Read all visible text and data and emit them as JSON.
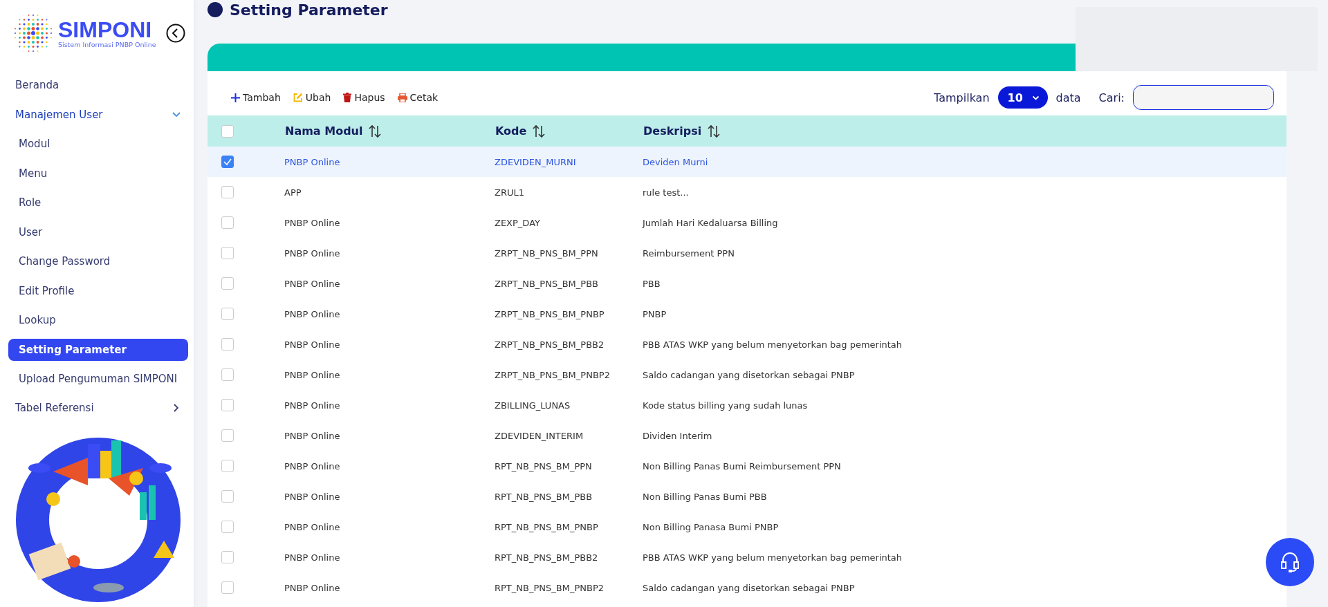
{
  "sidebar": {
    "logo": {
      "name": "SIMPONI",
      "tagline": "Sistem Informasi PNBP Online"
    },
    "items": [
      {
        "label": "Beranda",
        "selected": false
      },
      {
        "label": "Manajemen User",
        "selected": false,
        "expanded": true,
        "children": [
          {
            "label": "Modul",
            "selected": false
          },
          {
            "label": "Menu",
            "selected": false
          },
          {
            "label": "Role",
            "selected": false
          },
          {
            "label": "User",
            "selected": false
          },
          {
            "label": "Change Password",
            "selected": false
          },
          {
            "label": "Edit Profile",
            "selected": false
          },
          {
            "label": "Lookup",
            "selected": false
          },
          {
            "label": "Setting Parameter",
            "selected": true
          },
          {
            "label": "Upload Pengumuman SIMPONI",
            "selected": false
          }
        ]
      },
      {
        "label": "Tabel Referensi",
        "selected": false,
        "expanded": false
      }
    ]
  },
  "page_title": "Setting Parameter",
  "toolbar": {
    "actions": [
      {
        "kind": "add",
        "label": "Tambah"
      },
      {
        "kind": "edit",
        "label": "Ubah"
      },
      {
        "kind": "delete",
        "label": "Hapus"
      },
      {
        "kind": "print",
        "label": "Cetak"
      }
    ],
    "show_label": "Tampilkan",
    "page_size": "10",
    "show_suffix": "data",
    "search_label": "Cari:"
  },
  "table": {
    "all_checked": false,
    "columns": [
      "Nama Modul",
      "Kode",
      "Deskripsi"
    ],
    "rows": [
      {
        "checked": true,
        "cells": [
          "PNBP Online",
          "ZDEVIDEN_MURNI",
          "Deviden Murni"
        ]
      },
      {
        "checked": false,
        "cells": [
          "APP",
          "ZRUL1",
          "rule test..."
        ]
      },
      {
        "checked": false,
        "cells": [
          "PNBP Online",
          "ZEXP_DAY",
          "Jumlah Hari Kedaluarsa Billing"
        ]
      },
      {
        "checked": false,
        "cells": [
          "PNBP Online",
          "ZRPT_NB_PNS_BM_PPN",
          "Reimbursement PPN"
        ]
      },
      {
        "checked": false,
        "cells": [
          "PNBP Online",
          "ZRPT_NB_PNS_BM_PBB",
          "PBB"
        ]
      },
      {
        "checked": false,
        "cells": [
          "PNBP Online",
          "ZRPT_NB_PNS_BM_PNBP",
          "PNBP"
        ]
      },
      {
        "checked": false,
        "cells": [
          "PNBP Online",
          "ZRPT_NB_PNS_BM_PBB2",
          "PBB ATAS WKP yang belum menyetorkan bag pemerintah"
        ]
      },
      {
        "checked": false,
        "cells": [
          "PNBP Online",
          "ZRPT_NB_PNS_BM_PNBP2",
          "Saldo cadangan yang disetorkan sebagai PNBP"
        ]
      },
      {
        "checked": false,
        "cells": [
          "PNBP Online",
          "ZBILLING_LUNAS",
          "Kode status billing yang sudah lunas"
        ]
      },
      {
        "checked": false,
        "cells": [
          "PNBP Online",
          "ZDEVIDEN_INTERIM",
          "Dividen Interim"
        ]
      },
      {
        "checked": false,
        "cells": [
          "PNBP Online",
          "RPT_NB_PNS_BM_PPN",
          "Non Billing Panas Bumi Reimbursement PPN"
        ]
      },
      {
        "checked": false,
        "cells": [
          "PNBP Online",
          "RPT_NB_PNS_BM_PBB",
          "Non Billing Panas Bumi PBB"
        ]
      },
      {
        "checked": false,
        "cells": [
          "PNBP Online",
          "RPT_NB_PNS_BM_PNBP",
          "Non Billing Panasa Bumi PNBP"
        ]
      },
      {
        "checked": false,
        "cells": [
          "PNBP Online",
          "RPT_NB_PNS_BM_PBB2",
          "PBB ATAS WKP yang belum menyetorkan bag pemerintah"
        ]
      },
      {
        "checked": false,
        "cells": [
          "PNBP Online",
          "RPT_NB_PNS_BM_PNBP2",
          "Saldo cadangan yang disetorkan sebagai PNBP"
        ]
      }
    ]
  }
}
